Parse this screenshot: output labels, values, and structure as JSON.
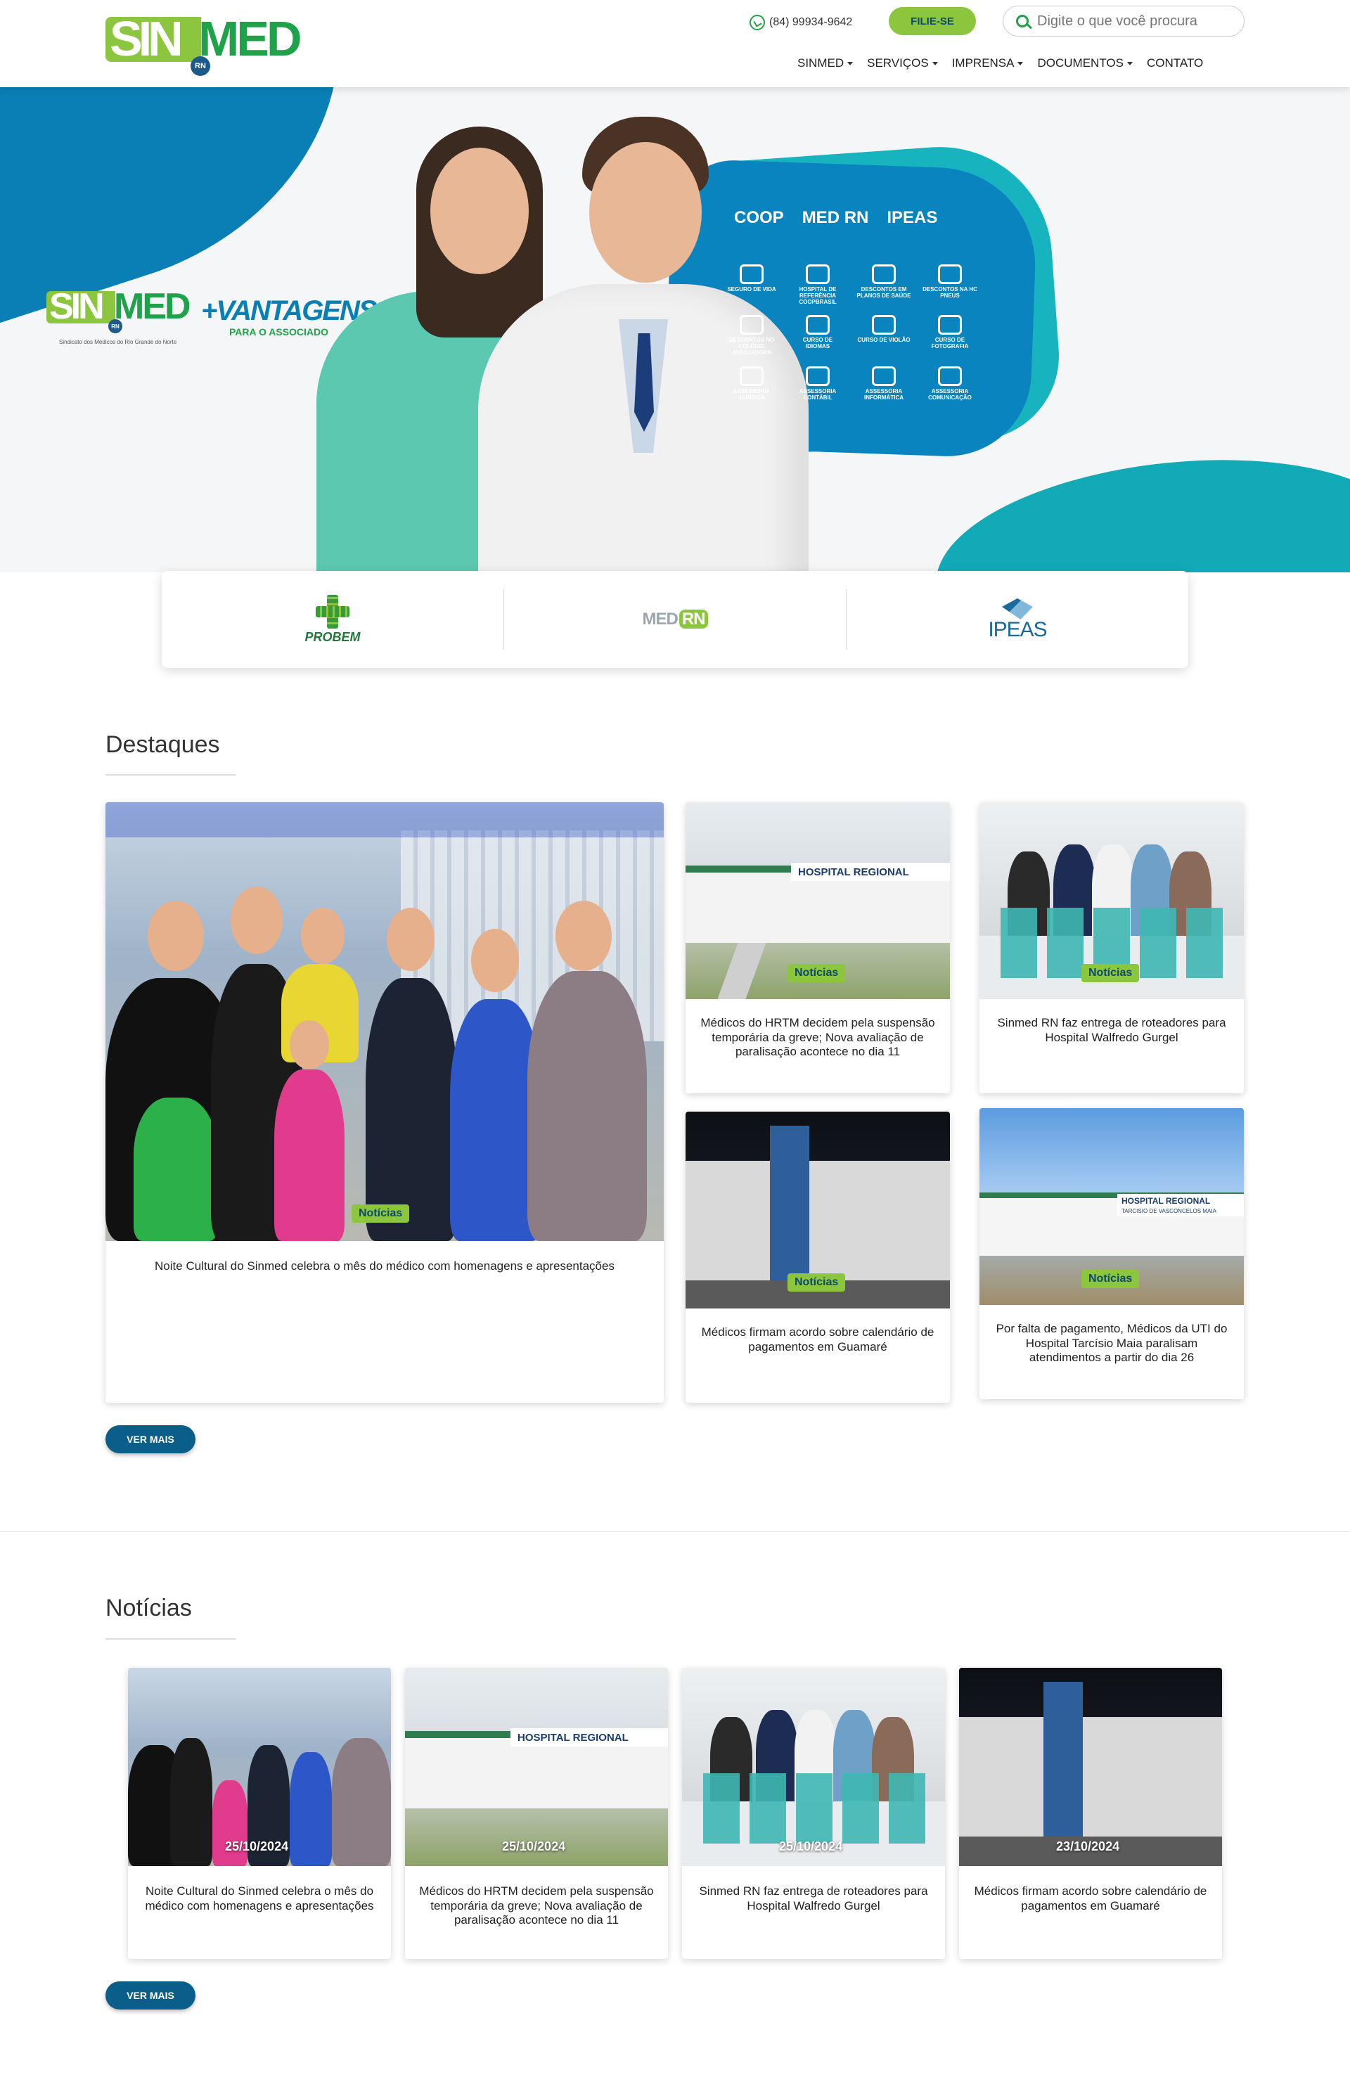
{
  "header": {
    "logo_text_sin": "SIN",
    "logo_text_med": "MED",
    "logo_badge": "RN",
    "phone": "(84) 99934-9642",
    "join_button": "FILIE-SE",
    "search_placeholder": "Digite o que você procura",
    "nav": [
      "SINMED",
      "SERVIÇOS",
      "IMPRENSA",
      "DOCUMENTOS",
      "CONTATO"
    ]
  },
  "hero": {
    "logo_sin": "SIN",
    "logo_med": "MED",
    "logo_badge": "RN",
    "logo_sub": "Sindicato dos Médicos do Rio Grande do Norte",
    "vantagens": "+VANTAGENS",
    "vantagens_sub": "PARA O ASSOCIADO",
    "brands": [
      "COOP",
      "MED RN",
      "IPEAS"
    ],
    "benefits": [
      "SEGURO DE VIDA",
      "HOSPITAL DE REFERÊNCIA COOPBRASIL",
      "DESCONTOS EM PLANOS DE SAÚDE",
      "DESCONTOS NA HC PNEUS",
      "DESCONTOS NO COLÉGIO AUXILIADORA",
      "CURSO DE IDIOMAS",
      "CURSO DE VIOLÃO",
      "CURSO DE FOTOGRAFIA",
      "ASSESSORIA JURÍDICA",
      "ASSESSORIA CONTÁBIL",
      "ASSESSORIA INFORMÁTICA",
      "ASSESSORIA COMUNICAÇÃO"
    ]
  },
  "partners": {
    "probem": "PROBEM",
    "medrn_med": "MED",
    "medrn_rn": "RN",
    "ipeas": "IPEAS"
  },
  "highlights": {
    "title": "Destaques",
    "items": [
      {
        "category": "Notícias",
        "title": "Noite Cultural do Sinmed celebra o mês do médico com homenagens e apresentações"
      },
      {
        "category": "Notícias",
        "title": "Médicos do HRTM decidem pela suspensão temporária da greve; Nova avaliação de paralisação acontece no dia 11"
      },
      {
        "category": "Notícias",
        "title": "Sinmed RN faz entrega de roteadores para Hospital Walfredo Gurgel"
      },
      {
        "category": "Notícias",
        "title": "Médicos firmam acordo sobre calendário de pagamentos em Guamaré"
      },
      {
        "category": "Notícias",
        "title": "Por falta de pagamento, Médicos da UTI do Hospital Tarcísio Maia paralisam atendimentos a partir do dia 26"
      }
    ],
    "more_button": "VER MAIS",
    "hospital_sign": "HOSPITAL REGIONAL",
    "hospital_sign_sub": "TARCISIO DE VASCONCELOS MAIA"
  },
  "news": {
    "title": "Notícias",
    "items": [
      {
        "date": "25/10/2024",
        "title": "Noite Cultural do Sinmed celebra o mês do médico com homenagens e apresentações"
      },
      {
        "date": "25/10/2024",
        "title": "Médicos do HRTM decidem pela suspensão temporária da greve; Nova avaliação de paralisação acontece no dia 11"
      },
      {
        "date": "25/10/2024",
        "title": "Sinmed RN faz entrega de roteadores para Hospital Walfredo Gurgel"
      },
      {
        "date": "23/10/2024",
        "title": "Médicos firmam acordo sobre calendário de pagamentos em Guamaré"
      }
    ],
    "more_button": "VER MAIS"
  }
}
